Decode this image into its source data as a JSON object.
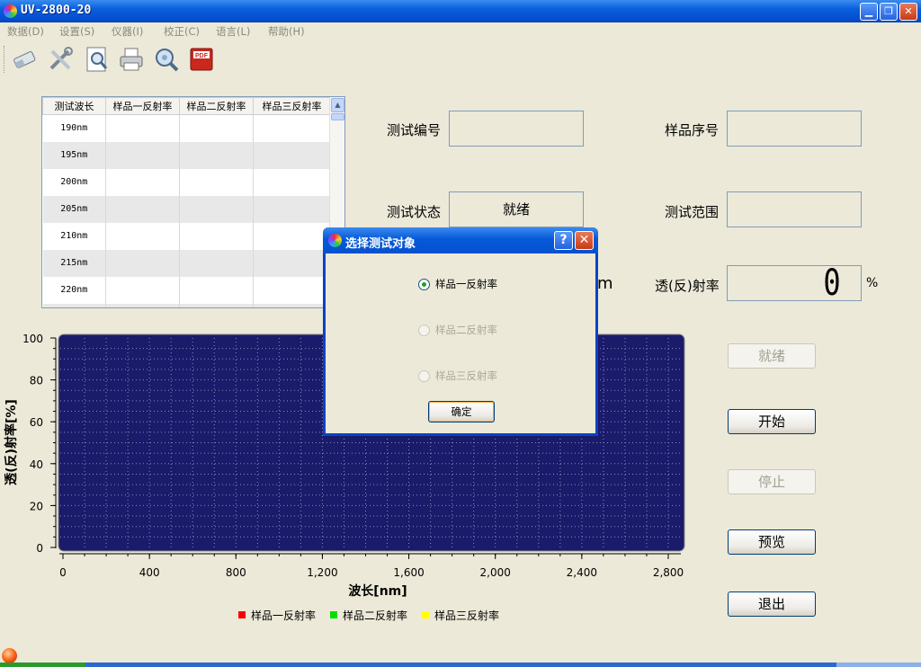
{
  "window": {
    "title": "UV-2800-20",
    "min": "▁",
    "max": "❐",
    "close": "✕"
  },
  "menu": [
    {
      "label": "数据(D)"
    },
    {
      "label": "设置(S)"
    },
    {
      "label": "仪器(I)"
    },
    {
      "label": "校正(C)"
    },
    {
      "label": "语言(L)"
    },
    {
      "label": "帮助(H)"
    }
  ],
  "toolbar": [
    "eraser-icon",
    "tools-icon",
    "preview-icon",
    "printer-icon",
    "search-settings-icon",
    "pdf-icon"
  ],
  "table": {
    "headers": [
      "测试波长",
      "样品一反射率",
      "样品二反射率",
      "样品三反射率"
    ],
    "rows": [
      {
        "wavelength": "190nm",
        "s1": "",
        "s2": "",
        "s3": ""
      },
      {
        "wavelength": "195nm",
        "s1": "",
        "s2": "",
        "s3": ""
      },
      {
        "wavelength": "200nm",
        "s1": "",
        "s2": "",
        "s3": ""
      },
      {
        "wavelength": "205nm",
        "s1": "",
        "s2": "",
        "s3": ""
      },
      {
        "wavelength": "210nm",
        "s1": "",
        "s2": "",
        "s3": ""
      },
      {
        "wavelength": "215nm",
        "s1": "",
        "s2": "",
        "s3": ""
      },
      {
        "wavelength": "220nm",
        "s1": "",
        "s2": "",
        "s3": ""
      },
      {
        "wavelength": "",
        "s1": "",
        "s2": "",
        "s3": ""
      }
    ]
  },
  "info": {
    "test_id_label": "测试编号",
    "test_id_value": "",
    "sample_no_label": "样品序号",
    "sample_no_value": "",
    "test_status_label": "测试状态",
    "test_status_value": "就绪",
    "test_range_label": "测试范围",
    "test_range_value": "",
    "unit_partial": "m",
    "transmittance_label": "透(反)射率",
    "transmittance_value": "0",
    "percent": "%"
  },
  "buttons": {
    "ready": "就绪",
    "start": "开始",
    "stop": "停止",
    "preview": "预览",
    "exit": "退出"
  },
  "dialog": {
    "title": "选择测试对象",
    "help": "?",
    "close": "✕",
    "options": [
      {
        "label": "样品一反射率",
        "checked": true,
        "enabled": true
      },
      {
        "label": "样品二反射率",
        "checked": false,
        "enabled": false
      },
      {
        "label": "样品三反射率",
        "checked": false,
        "enabled": false
      }
    ],
    "ok": "确定"
  },
  "chart_data": {
    "type": "line",
    "xlabel": "波长[nm]",
    "ylabel": "透(反)射率[%]",
    "xlim": [
      0,
      2900
    ],
    "ylim": [
      0,
      100
    ],
    "x_ticks": [
      "0",
      "400",
      "800",
      "1,200",
      "1,600",
      "2,000",
      "2,400",
      "2,800"
    ],
    "y_ticks": [
      "0",
      "20",
      "40",
      "60",
      "80",
      "100"
    ],
    "background": "#1b1b6b",
    "grid": true,
    "legend_position": "bottom",
    "series": [
      {
        "name": "样品一反射率",
        "color": "#ff0000",
        "values": []
      },
      {
        "name": "样品二反射率",
        "color": "#00e000",
        "values": []
      },
      {
        "name": "样品三反射率",
        "color": "#ffff00",
        "values": []
      }
    ]
  }
}
